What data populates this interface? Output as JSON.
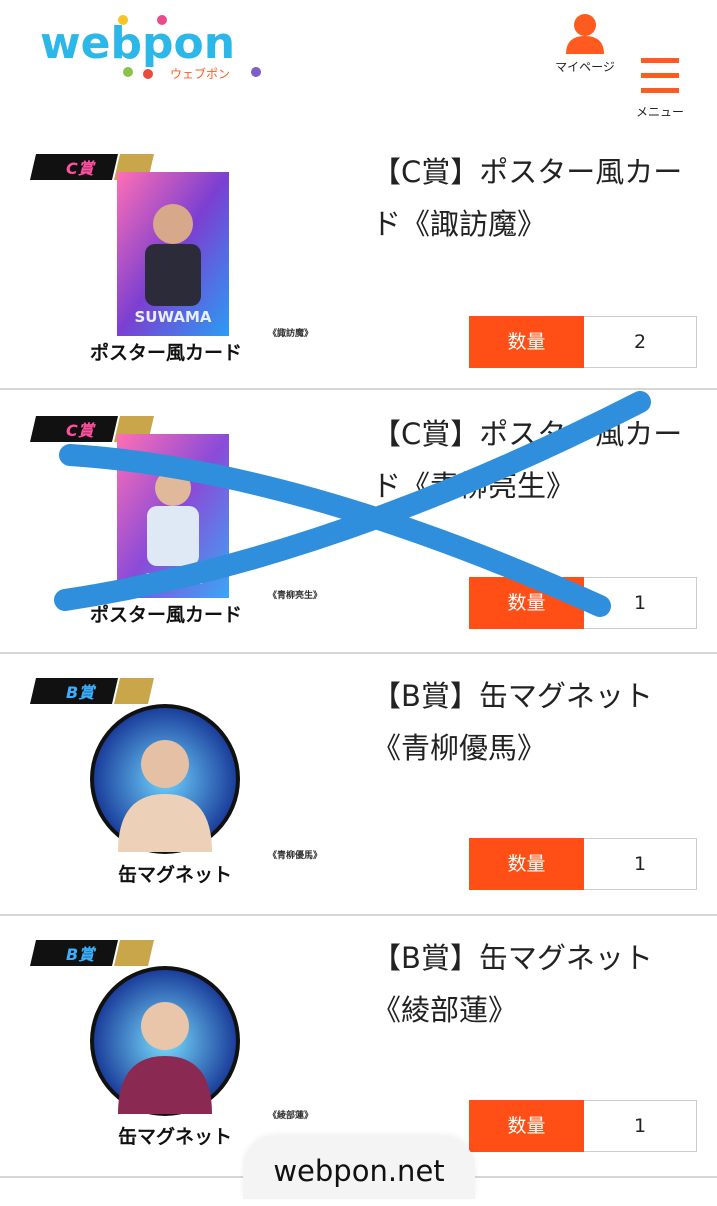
{
  "header": {
    "logo_text": "webpon",
    "logo_sub": "ウェブポン",
    "mypage_label": "マイページ",
    "menu_label": "メニュー"
  },
  "colors": {
    "accent": "#ff5a1f",
    "strike_blue": "#2f8fdc"
  },
  "items": [
    {
      "badge": "C賞",
      "title": "【C賞】ポスター風カード《諏訪魔》",
      "caption": "ポスター風カード",
      "subcaption": "《諏訪魔》",
      "thumb_text": "SUWAMA",
      "qty_label": "数量",
      "qty_value": "2",
      "struck": false
    },
    {
      "badge": "C賞",
      "title": "【C賞】ポスター風カード《青柳亮生》",
      "caption": "ポスター風カード",
      "subcaption": "《青柳亮生》",
      "thumb_text": "ATSUKI",
      "qty_label": "数量",
      "qty_value": "1",
      "struck": true
    },
    {
      "badge": "B賞",
      "title": "【B賞】缶マグネット《青柳優馬》",
      "caption": "缶マグネット",
      "subcaption": "《青柳優馬》",
      "qty_label": "数量",
      "qty_value": "1",
      "struck": false
    },
    {
      "badge": "B賞",
      "title": "【B賞】缶マグネット《綾部蓮》",
      "caption": "缶マグネット",
      "subcaption": "《綾部蓮》",
      "qty_label": "数量",
      "qty_value": "1",
      "struck": false
    }
  ],
  "footer": {
    "domain": "webpon.net"
  }
}
